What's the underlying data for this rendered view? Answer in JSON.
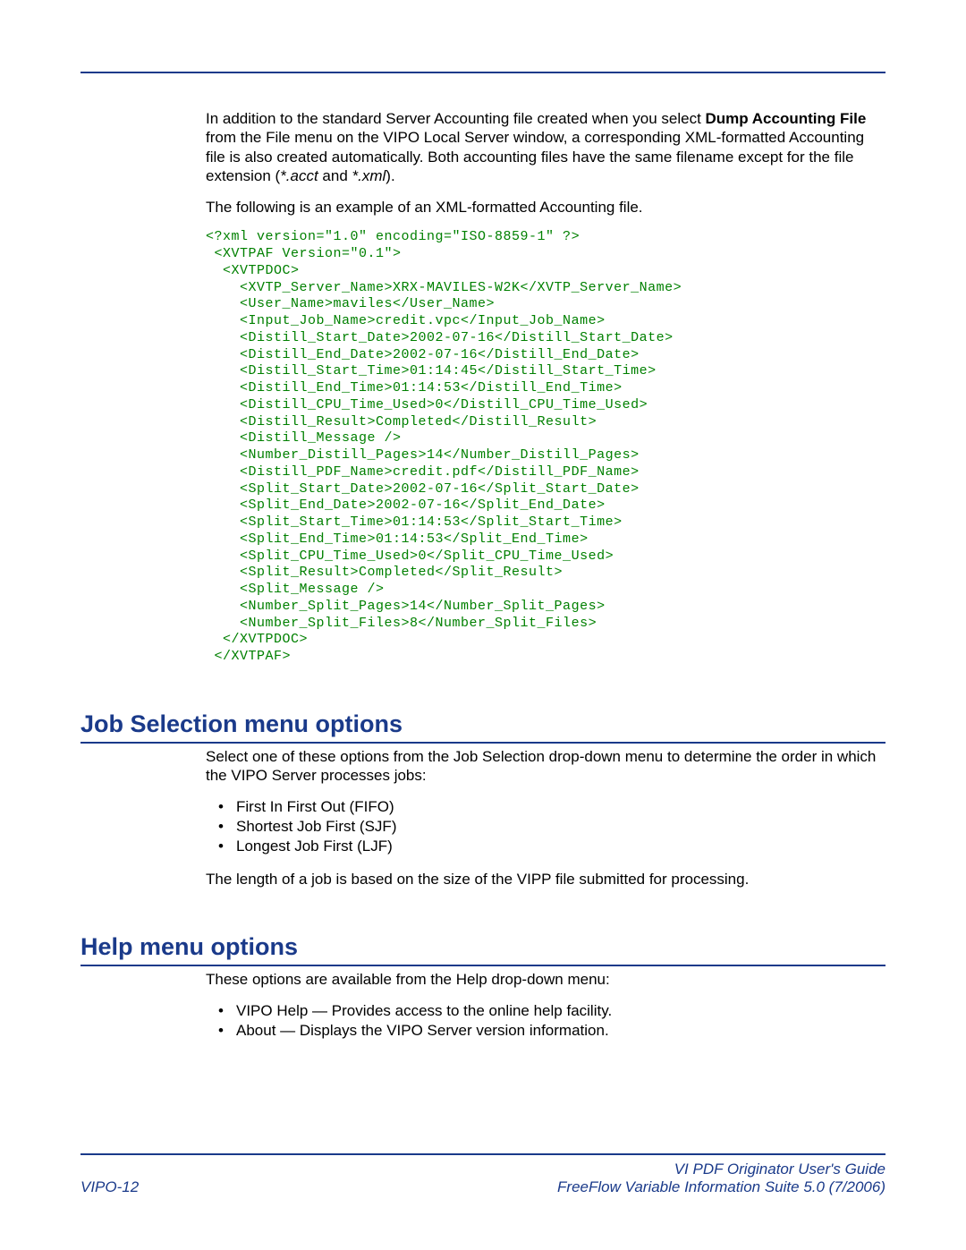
{
  "intro": {
    "p1_pre": "In addition to the standard Server Accounting file created when you select ",
    "p1_bold": "Dump Accounting File",
    "p1_post": " from the File menu on the VIPO Local Server window, a corresponding XML-formatted Accounting file is also created automatically. Both accounting files have the same filename except for the file extension (",
    "p1_ext1": "*.acct",
    "p1_and": " and ",
    "p1_ext2": "*.xml",
    "p1_close": ").",
    "p2": "The following is an example of an XML-formatted Accounting file."
  },
  "code": "<?xml version=\"1.0\" encoding=\"ISO-8859-1\" ?>\n <XVTPAF Version=\"0.1\">\n  <XVTPDOC>\n    <XVTP_Server_Name>XRX-MAVILES-W2K</XVTP_Server_Name>\n    <User_Name>maviles</User_Name>\n    <Input_Job_Name>credit.vpc</Input_Job_Name>\n    <Distill_Start_Date>2002-07-16</Distill_Start_Date>\n    <Distill_End_Date>2002-07-16</Distill_End_Date>\n    <Distill_Start_Time>01:14:45</Distill_Start_Time>\n    <Distill_End_Time>01:14:53</Distill_End_Time>\n    <Distill_CPU_Time_Used>0</Distill_CPU_Time_Used>\n    <Distill_Result>Completed</Distill_Result>\n    <Distill_Message />\n    <Number_Distill_Pages>14</Number_Distill_Pages>\n    <Distill_PDF_Name>credit.pdf</Distill_PDF_Name>\n    <Split_Start_Date>2002-07-16</Split_Start_Date>\n    <Split_End_Date>2002-07-16</Split_End_Date>\n    <Split_Start_Time>01:14:53</Split_Start_Time>\n    <Split_End_Time>01:14:53</Split_End_Time>\n    <Split_CPU_Time_Used>0</Split_CPU_Time_Used>\n    <Split_Result>Completed</Split_Result>\n    <Split_Message />\n    <Number_Split_Pages>14</Number_Split_Pages>\n    <Number_Split_Files>8</Number_Split_Files>\n  </XVTPDOC>\n </XVTPAF>",
  "job_selection": {
    "heading": "Job Selection menu options",
    "p1": "Select one of these options from the Job Selection drop-down menu to determine the order in which the VIPO Server processes jobs:",
    "items": [
      "First In First Out (FIFO)",
      "Shortest Job First (SJF)",
      "Longest Job First (LJF)"
    ],
    "p2": "The length of a job is based on the size of the VIPP file submitted for processing."
  },
  "help": {
    "heading": "Help menu options",
    "p1": "These options are available from the Help drop-down menu:",
    "items": [
      "VIPO Help — Provides access to the online help facility.",
      "About — Displays the VIPO Server version information."
    ]
  },
  "footer": {
    "left": "VIPO-12",
    "right1": "VI PDF Originator User's Guide",
    "right2": "FreeFlow Variable Information Suite 5.0 (7/2006)"
  }
}
